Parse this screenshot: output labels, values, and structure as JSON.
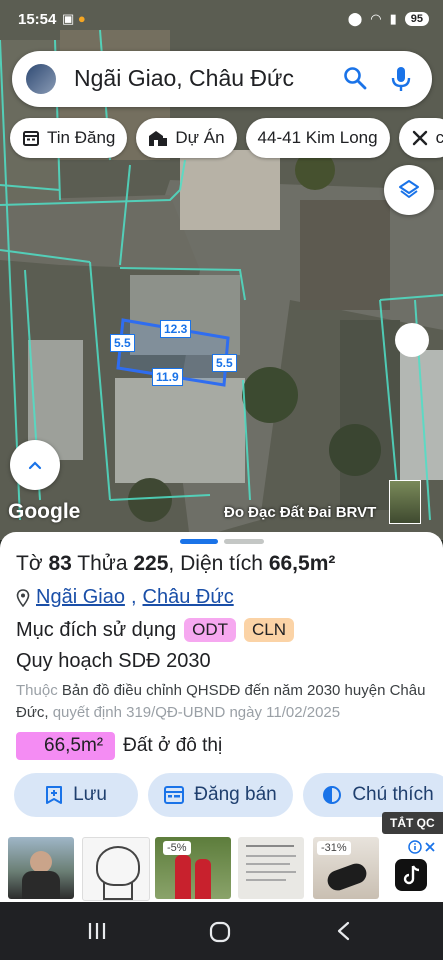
{
  "status": {
    "time": "15:54",
    "battery": "95"
  },
  "search": {
    "query": "Ngãi Giao, Châu Đức"
  },
  "chips": [
    {
      "label": "Tin Đăng",
      "icon": "calendar-icon"
    },
    {
      "label": "Dự Án",
      "icon": "buildings-icon"
    },
    {
      "label": "44-41 Kim Long",
      "icon": ""
    },
    {
      "label": "c",
      "icon": "tools-icon"
    }
  ],
  "parcel_dims": {
    "top": "12.3",
    "left": "5.5",
    "right": "5.5",
    "bottom": "11.9"
  },
  "map": {
    "logo": "Google",
    "attribution": "Đo Đạc Đất Đai BRVT"
  },
  "sheet": {
    "to_label": "Tờ",
    "to_value": "83",
    "thua_label": "Thửa",
    "thua_value": "225",
    "dientich_label": "Diện tích",
    "dientich_value": "66,5m²",
    "location_1": "Ngãi Giao",
    "location_sep": ",",
    "location_2": "Châu Đức",
    "purpose_label": "Mục đích sử dụng",
    "purpose_badges": [
      {
        "text": "ODT",
        "color": "#f6a8f0"
      },
      {
        "text": "CLN",
        "color": "#fbd3a6"
      }
    ],
    "plan_label": "Quy hoạch SDĐ 2030",
    "desc_prefix": "Thuộc",
    "desc_main": "Bản đồ điều chỉnh QHSDĐ đến năm 2030 huyện Châu Đức,",
    "desc_suffix": "quyết định 319/QĐ-UBND ngày 11/02/2025",
    "area_value": "66,5m²",
    "area_label": "Đất ở đô thị",
    "actions": [
      {
        "label": "Lưu",
        "icon": "bookmark-plus-icon"
      },
      {
        "label": "Đăng bán",
        "icon": "listing-icon"
      },
      {
        "label": "Chú thích",
        "icon": "contrast-icon"
      }
    ]
  },
  "ads": {
    "close_label": "TẮT QC",
    "discount_1": "-5%",
    "discount_2": "-31%"
  }
}
